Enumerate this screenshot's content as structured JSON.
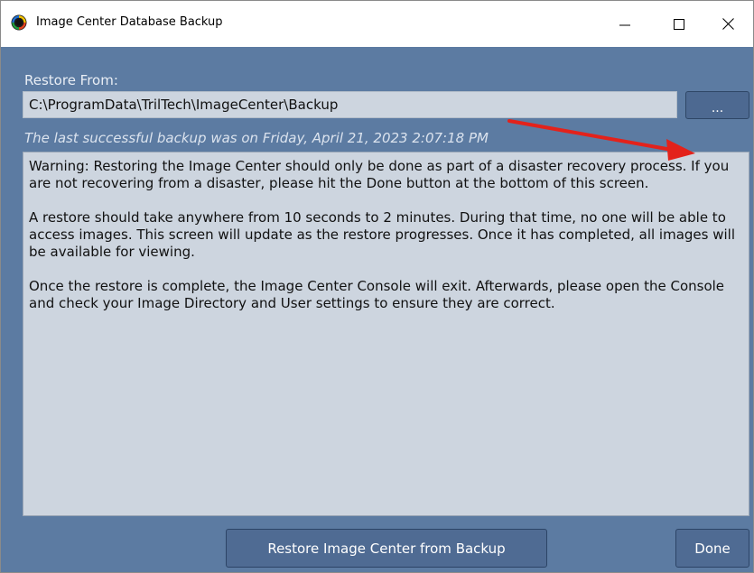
{
  "window": {
    "title": "Image Center Database Backup",
    "app_icon": "image-center-logo-icon",
    "controls": [
      "minimize-icon",
      "maximize-icon",
      "close-icon"
    ]
  },
  "restore": {
    "label": "Restore From:",
    "path_value": "C:\\ProgramData\\TrilTech\\ImageCenter\\Backup",
    "browse_label": "..."
  },
  "status": {
    "last_backup": "The last successful backup was on Friday, April 21, 2023 2:07:18 PM"
  },
  "message": {
    "paragraphs": [
      "Warning: Restoring the Image Center should only be done as part of a disaster recovery process. If you are not recovering from a disaster, please hit the Done button at the bottom of this screen.",
      "A restore should take anywhere from 10 seconds to 2 minutes. During that time, no one will be able to access images. This screen will update as the restore progresses. Once it has completed, all images will be available for viewing.",
      "Once the restore is complete, the Image Center Console will exit. Afterwards, please open the Console and check your Image Directory and User settings to ensure they are correct."
    ]
  },
  "buttons": {
    "restore_label": "Restore Image Center from Backup",
    "done_label": "Done"
  },
  "colors": {
    "client_background": "#5c7ba2",
    "field_background": "#cdd5df",
    "button_background": "#4f6b93",
    "annotation_arrow": "#e3221b"
  }
}
